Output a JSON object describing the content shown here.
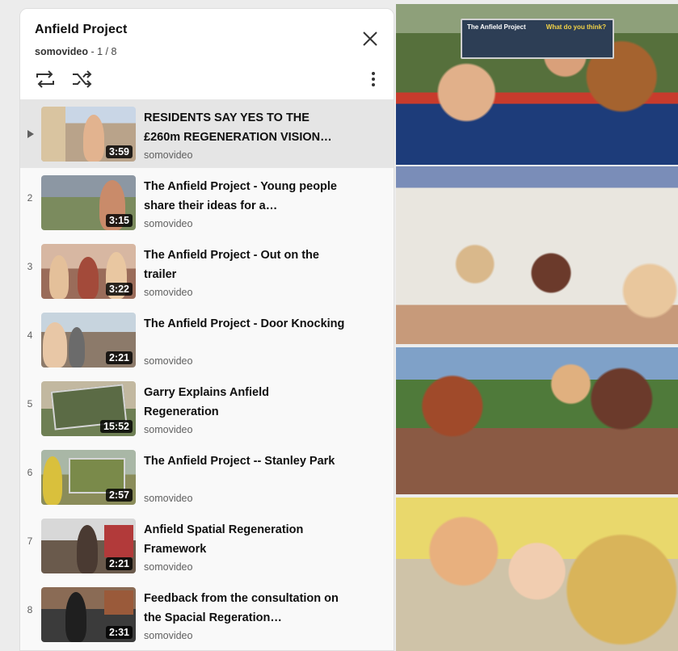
{
  "playlist": {
    "title": "Anfield Project",
    "owner": "somovideo",
    "position": "1 / 8",
    "separator": " - "
  },
  "icons": {
    "close": "close-icon",
    "loop": "loop-icon",
    "shuffle": "shuffle-icon",
    "more": "more-vert-icon"
  },
  "videos": [
    {
      "index": "▶",
      "title": "RESIDENTS SAY YES TO THE £260m REGENERATION VISION…",
      "channel": "somovideo",
      "duration": "3:59",
      "active": true
    },
    {
      "index": "2",
      "title": "The Anfield Project - Young people share their ideas for a…",
      "channel": "somovideo",
      "duration": "3:15"
    },
    {
      "index": "3",
      "title": "The Anfield Project - Out on the trailer",
      "channel": "somovideo",
      "duration": "3:22"
    },
    {
      "index": "4",
      "title": "The Anfield Project - Door Knocking",
      "channel": "somovideo",
      "duration": "2:21"
    },
    {
      "index": "5",
      "title": "Garry Explains Anfield Regeneration",
      "channel": "somovideo",
      "duration": "15:52"
    },
    {
      "index": "6",
      "title": "The Anfield Project -- Stanley Park",
      "channel": "somovideo",
      "duration": "2:57"
    },
    {
      "index": "7",
      "title": "Anfield Spatial Regeneration Framework",
      "channel": "somovideo",
      "duration": "2:21"
    },
    {
      "index": "8",
      "title": "Feedback from the consultation on the Spacial Regeration…",
      "channel": "somovideo",
      "duration": "2:31"
    }
  ],
  "photos": {
    "sign_left": "The Anfield Project",
    "sign_right": "What do you think?"
  }
}
